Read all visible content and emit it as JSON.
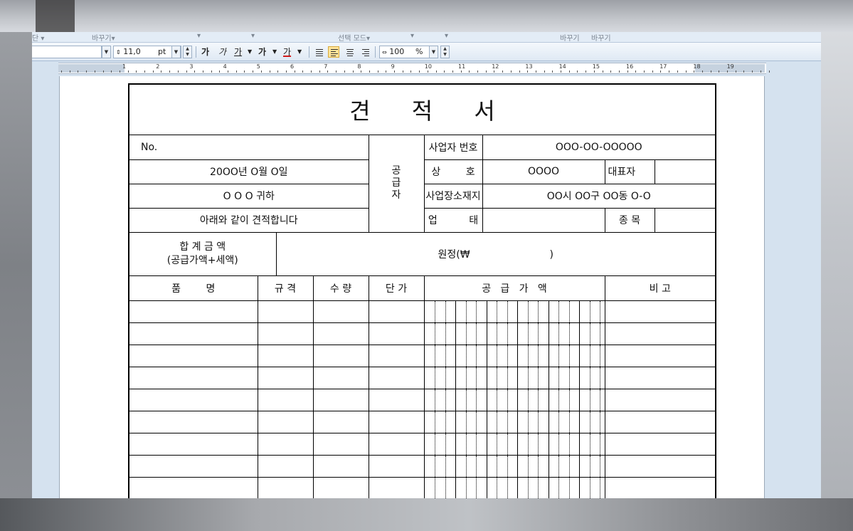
{
  "menu": {
    "items": [
      "단 ▾",
      "바꾸기▾",
      "▾",
      "▾",
      "선택 모드▾",
      "▾",
      "▾",
      "바꾸기",
      "바꾸기"
    ]
  },
  "toolbar": {
    "font_size_value": "11,0",
    "font_size_unit": "pt",
    "bold_label": "가",
    "italic_label": "가",
    "underline_label": "가",
    "strike_label": "가",
    "color_label": "가",
    "zoom_value": "100",
    "zoom_unit": "%"
  },
  "ruler": {
    "numbers": [
      "1",
      "2",
      "3",
      "4",
      "5",
      "6",
      "7",
      "8",
      "9",
      "10",
      "11",
      "12",
      "13",
      "14",
      "15",
      "16",
      "17",
      "18",
      "19"
    ]
  },
  "document": {
    "title": "견 적 서",
    "no_label": "No.",
    "date": "20OO년 O월 O일",
    "recipient": "O O O 귀하",
    "intro": "아래와 같이 견적합니다",
    "supplier_label_chars": [
      "공",
      "급",
      "자"
    ],
    "reg_no_label": "사업자 번호",
    "reg_no_value": "OOO-OO-OOOOO",
    "trade_name_label": "상        호",
    "trade_name_value": "OOOO",
    "representative_label": "대표자",
    "address_label": "사업장소재지",
    "address_value": "OO시 OO구 OO동 O-O",
    "business_type_label": "업          태",
    "business_item_label": "종 목",
    "total_label_line1": "합 계 금 액",
    "total_label_line2": "(공급가액+세액)",
    "total_value_prefix": "원정(₩",
    "total_value_suffix": ")",
    "headers": {
      "item": "품        명",
      "spec": "규 격",
      "qty": "수 량",
      "unit_price": "단 가",
      "supply_amount": "공   급   가   액",
      "note": "비 고"
    },
    "empty_rows": 9
  },
  "colors": {
    "app_bg": "#d5e2ef",
    "toolbar_bg": "#e5eef7",
    "align_active": "#ffe59a",
    "color_underline": "#d11a1a"
  }
}
